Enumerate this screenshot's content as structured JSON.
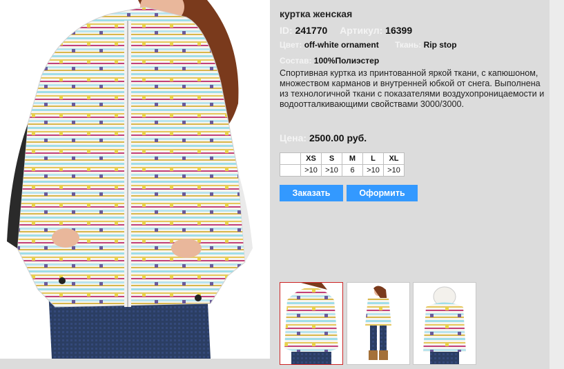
{
  "product": {
    "title": "куртка женская",
    "id_label": "ID:",
    "id_value": "241770",
    "article_label": "Артикул:",
    "article_value": "16399",
    "color_label": "Цвет:",
    "color_value": "off-white ornament",
    "fabric_label": "Ткань:",
    "fabric_value": "Rip stop",
    "composition_label": "Состав:",
    "composition_value": "100%Полиэстер",
    "description": "Спортивная куртка из принтованной яркой ткани, с капюшоном, множеством карманов и внутренней юбкой от снега. Выполнена из технологичной ткани с показателями воздухопроницаемости  и водоотталкивающими свойствами 3000/3000.",
    "price_label": "Цена:",
    "price_value": "2500.00 руб."
  },
  "sizes": {
    "headers": [
      "XS",
      "S",
      "M",
      "L",
      "XL"
    ],
    "stock": [
      ">10",
      ">10",
      "6",
      ">10",
      ">10"
    ]
  },
  "buttons": {
    "order": "Заказать",
    "checkout": "Оформить"
  },
  "colors": {
    "accent": "#3399ff",
    "label_text": "#f4f4f4",
    "active_thumb_border": "#cc2222",
    "background": "#dcdcdc"
  }
}
